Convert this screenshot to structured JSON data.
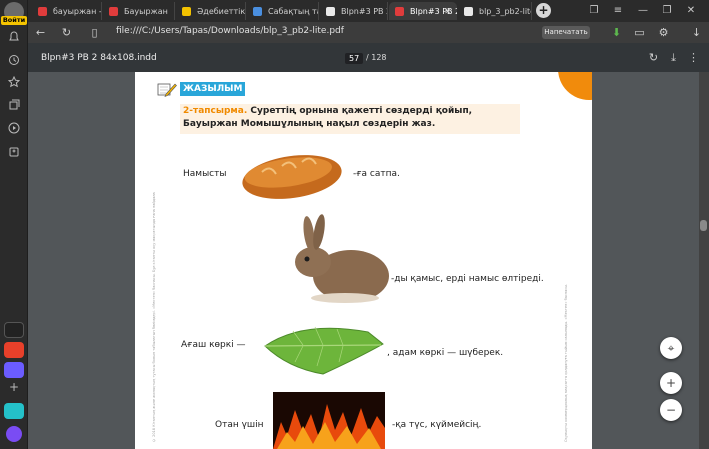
{
  "browser": {
    "login_badge": "Войти",
    "tabs": [
      {
        "label": "бауыржан -ка",
        "fav": "#e03c3c"
      },
      {
        "label": "Бауыржан",
        "fav": "#e03c3c"
      },
      {
        "label": "Әдебиеттік оқ",
        "fav": "#f3c200"
      },
      {
        "label": "Сабақтың тақ",
        "fav": "#4a8fe0"
      },
      {
        "label": "Blpn#3 PB 2",
        "fav": "#e8e8e8"
      },
      {
        "label": "Blpn#3 PB 2",
        "fav": "#e03c3c"
      },
      {
        "label": "blp_3_pb2-lite",
        "fav": "#e8e8e8"
      }
    ],
    "new_tab": "+",
    "url": "file:///C:/Users/Tapas/Downloads/blp_3_pb2-lite.pdf",
    "print_button": "Напечатать"
  },
  "pdf": {
    "title": "Blpn#3 PB 2 84x108.indd",
    "page": "57",
    "total": "/ 128"
  },
  "page": {
    "section": "ЖАЗЫЛЫМ",
    "task_number": "2-тапсырма.",
    "task_text": " Суреттің орнына қажетті сөздерді қойып, Бауыржан Момышұлының нақыл сөздерін жаз.",
    "rows": [
      {
        "before": "Намысты",
        "after": "-ға сатпа."
      },
      {
        "before": "",
        "after": "-ды қамыс, ерді намыс өлтіреді."
      },
      {
        "before": "Ағаш көркі —",
        "after": ", адам көркі — шүберек."
      },
      {
        "before": "Отан үшін",
        "after": "-қа түс, күймейсің."
      }
    ],
    "side_text_left": "© 2018 Кітаптың және жинақтың тұтасы болып табылатын бөлімдері. «Мектеп» баспасы. Бұл кітапты оқу мақсатында ғана пайдалануға рұқсат етіледі.",
    "side_text_right": "Оқулықты коммерциялық мақсатта қолдануға тыйым салынады. «Мектеп» баспасы."
  }
}
